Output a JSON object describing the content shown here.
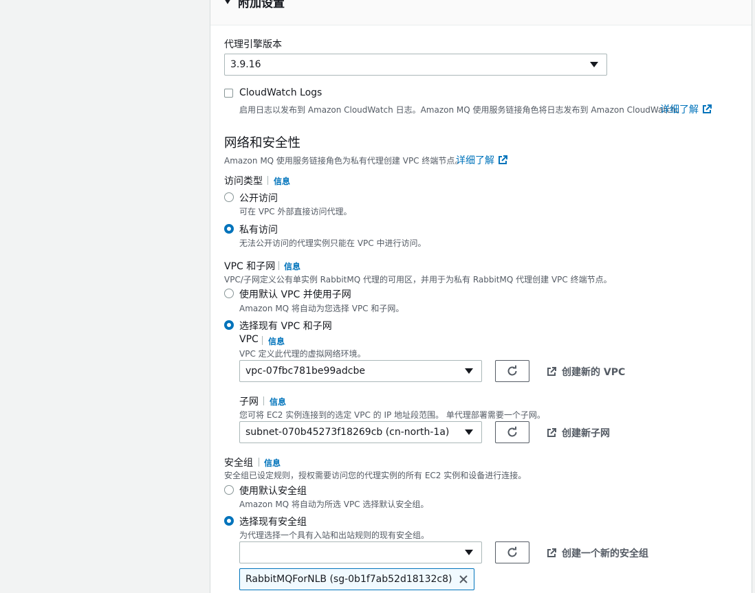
{
  "section": {
    "title": "附加设置"
  },
  "engine": {
    "label": "代理引擎版本",
    "value": "3.9.16"
  },
  "cloudwatch": {
    "label": "CloudWatch Logs",
    "desc": "启用日志以发布到 Amazon CloudWatch 日志。Amazon MQ 使用服务链接角色将日志发布到 Amazon CloudWatch。",
    "learn_more": "详细了解"
  },
  "network": {
    "title": "网络和安全性",
    "desc": "Amazon MQ 使用服务链接角色为私有代理创建 VPC 终端节点。",
    "learn_more": "详细了解"
  },
  "access": {
    "label": "访问类型",
    "info": "信息",
    "options": [
      {
        "label": "公开访问",
        "desc": "可在 VPC 外部直接访问代理。"
      },
      {
        "label": "私有访问",
        "desc": "无法公开访问的代理实例只能在 VPC 中进行访问。"
      }
    ]
  },
  "vpc_subnet": {
    "label": "VPC 和子网",
    "info": "信息",
    "desc": "VPC/子网定义公有单实例 RabbitMQ 代理的可用区，并用于为私有 RabbitMQ 代理创建 VPC 终端节点。",
    "options": [
      {
        "label": "使用默认 VPC 并使用子网",
        "desc": "Amazon MQ 将自动为您选择 VPC 和子网。"
      },
      {
        "label": "选择现有 VPC 和子网"
      }
    ]
  },
  "vpc": {
    "label": "VPC",
    "info": "信息",
    "desc": "VPC 定义此代理的虚拟网络环境。",
    "value": "vpc-07fbc781be99adcbe",
    "create": "创建新的 VPC"
  },
  "subnet": {
    "label": "子网",
    "info": "信息",
    "desc": "您可将 EC2 实例连接到的选定 VPC 的 IP 地址段范围。 单代理部署需要一个子网。",
    "value": "subnet-070b45273f18269cb (cn-north-1a)",
    "create": "创建新子网"
  },
  "security": {
    "label": "安全组",
    "info": "信息",
    "desc": "安全组已设定规则，授权需要访问您的代理实例的所有 EC2 实例和设备进行连接。",
    "options": [
      {
        "label": "使用默认安全组",
        "desc": "Amazon MQ 将自动为所选 VPC 选择默认安全组。"
      },
      {
        "label": "选择现有安全组",
        "desc": "为代理选择一个具有入站和出站规则的现有安全组。"
      }
    ],
    "value": "",
    "create": "创建一个新的安全组",
    "token": "RabbitMQForNLB (sg-0b1f7ab52d18132c8)"
  },
  "colors": {
    "link": "#0073bb",
    "text": "#16191f",
    "muted": "#545b64"
  },
  "icons": [
    "caret-down-icon",
    "checkbox-icon",
    "external-link-icon",
    "radio-icon",
    "refresh-icon",
    "close-icon"
  ]
}
